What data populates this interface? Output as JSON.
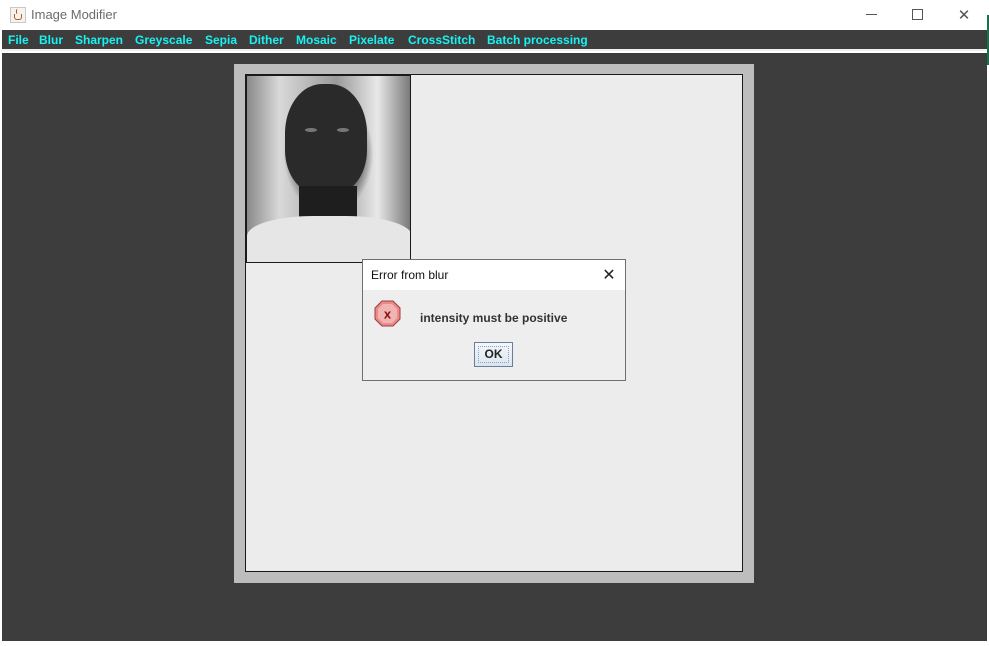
{
  "window": {
    "title": "Image Modifier",
    "controls": {
      "minimize": "—",
      "maximize": "☐",
      "close": "✕"
    }
  },
  "menubar": {
    "items": [
      {
        "label": "File"
      },
      {
        "label": "Blur"
      },
      {
        "label": "Sharpen"
      },
      {
        "label": "Greyscale"
      },
      {
        "label": "Sepia"
      },
      {
        "label": "Dither"
      },
      {
        "label": "Mosaic"
      },
      {
        "label": "Pixelate"
      },
      {
        "label": "CrossStitch"
      },
      {
        "label": "Batch processing"
      }
    ],
    "text_color": "#19f2f2",
    "background": "#3d3d3d"
  },
  "canvas": {
    "image_icon": "portrait-photo"
  },
  "dialog": {
    "title": "Error from blur",
    "message": "intensity must be positive",
    "ok_label": "OK",
    "icon": "error-icon",
    "close_glyph": "✕"
  }
}
